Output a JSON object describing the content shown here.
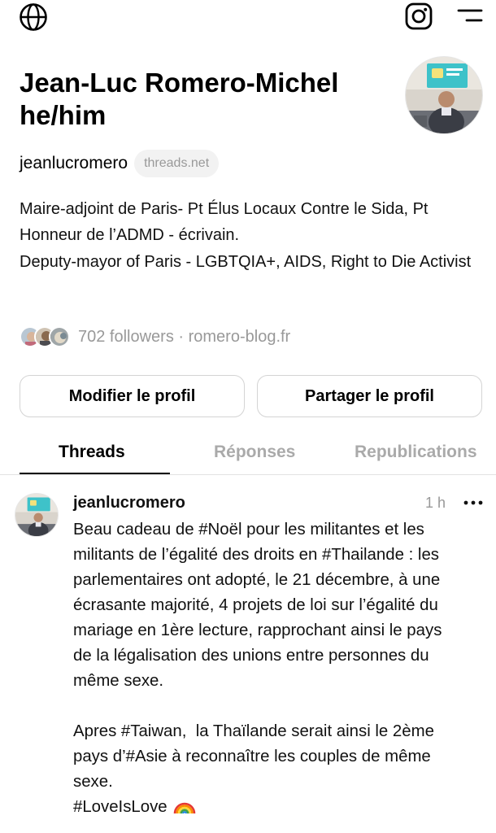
{
  "topbar": {
    "icons": [
      "globe-icon",
      "instagram-icon",
      "menu-icon"
    ]
  },
  "profile": {
    "name_line1": "Jean-Luc Romero-Michel",
    "name_line2": "he/him",
    "handle": "jeanlucromero",
    "domain_badge": "threads.net",
    "bio": [
      "Maire-adjoint de Paris- Pt Élus Locaux Contre le Sida, Pt Honneur de l’ADMD - écrivain.",
      "Deputy-mayor of Paris - LGBTQIA+, AIDS, Right to Die Activist"
    ],
    "followers_text": "702 followers · romero-blog.fr"
  },
  "actions": {
    "edit_label": "Modifier le profil",
    "share_label": "Partager le profil"
  },
  "tabs": [
    {
      "label": "Threads",
      "active": true
    },
    {
      "label": "Réponses",
      "active": false
    },
    {
      "label": "Republications",
      "active": false
    }
  ],
  "post": {
    "author": "jeanlucromero",
    "time": "1 h",
    "paragraph1": [
      "Beau cadeau de #Noël pour les militantes et les",
      "militants de l’égalité des droits en #Thailande : les",
      "parlementaires ont adopté, le 21 décembre, à une",
      "écrasante majorité, 4 projets de loi sur l’égalité du",
      "mariage en 1ère lecture, rapprochant ainsi le pays",
      "de la légalisation des unions entre personnes du",
      "même sexe."
    ],
    "paragraph2": [
      "Apres #Taiwan,  la Thaïlande serait ainsi le 2ème",
      "pays d’#Asie à reconnaître les couples de même",
      "sexe."
    ],
    "hashtag_line": "#LoveIsLove",
    "emoji_icon": "rainbow-icon"
  },
  "colors": {
    "text": "#111111",
    "muted": "#999999",
    "border": "#d4d4d4",
    "badge_bg": "#f2f2f2"
  }
}
